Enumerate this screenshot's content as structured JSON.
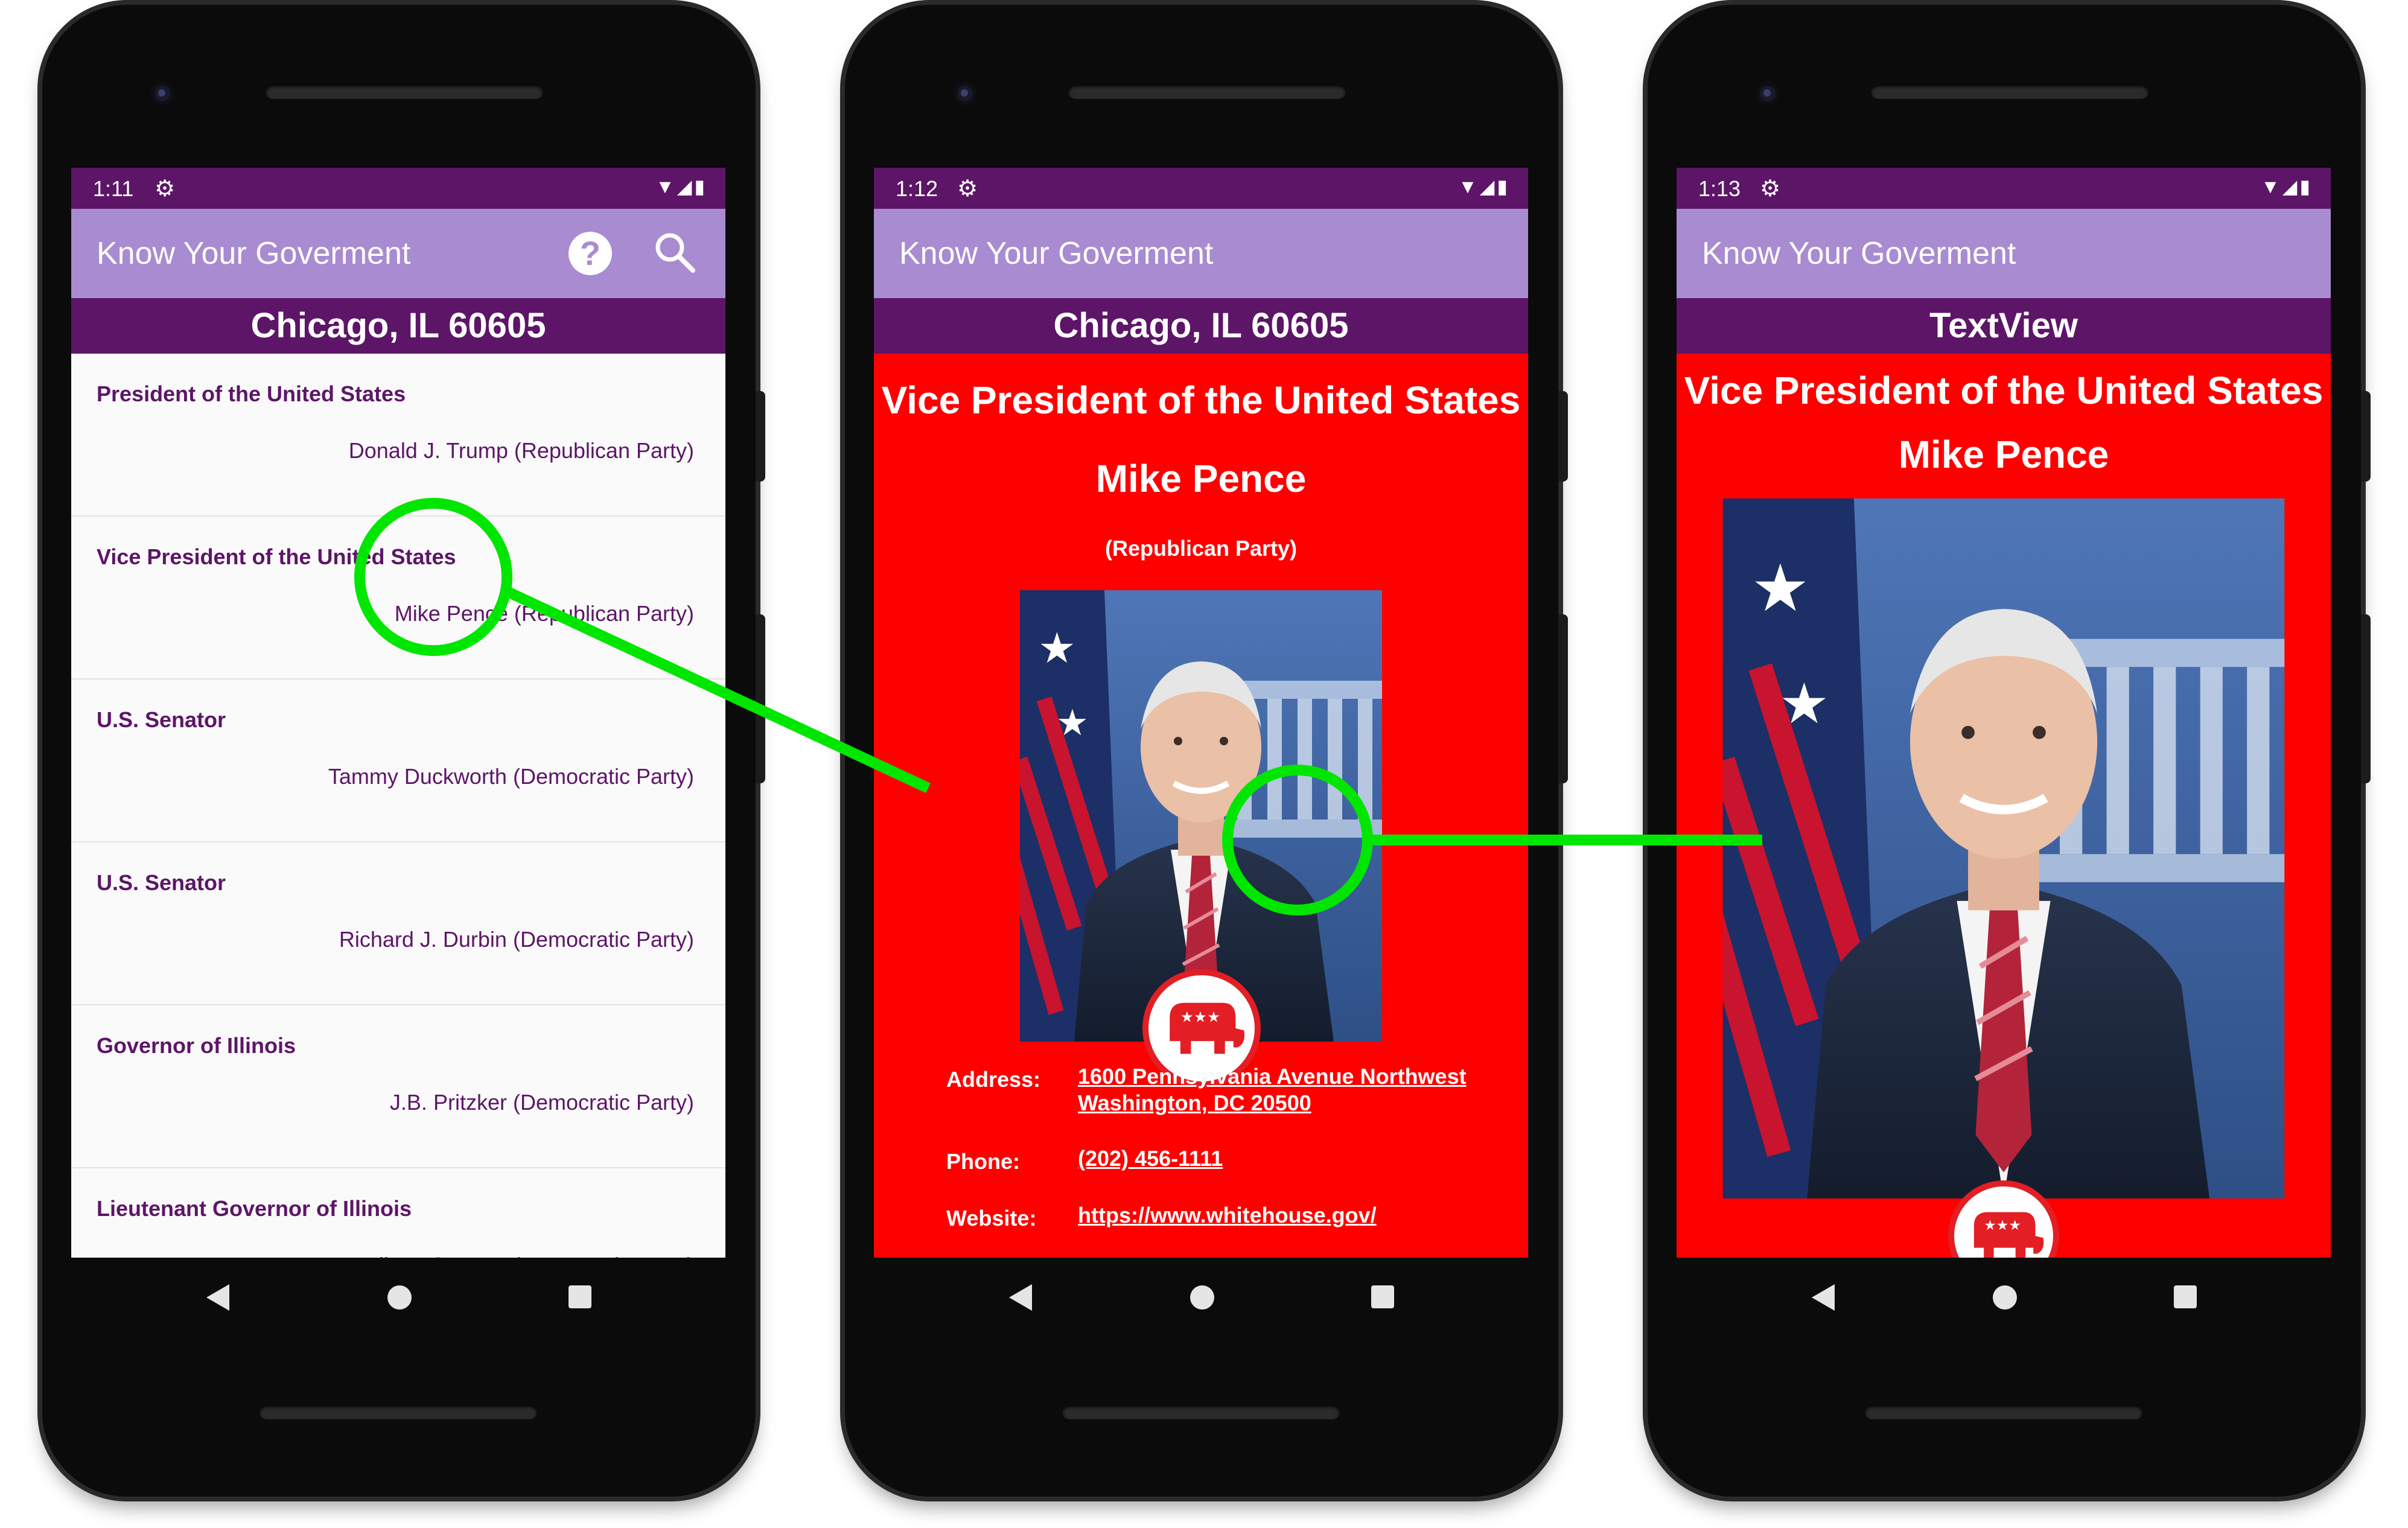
{
  "colors": {
    "status_bar": "#5d1568",
    "app_bar": "#a98bd1",
    "location_bar": "#5d1568",
    "list_text": "#5d1568",
    "detail_background": "#ff0000",
    "annotation": "#00e600"
  },
  "phone1": {
    "status": {
      "time": "1:11"
    },
    "app_title": "Know Your Goverment",
    "location": "Chicago, IL 60605",
    "officials": [
      {
        "office": "President of the United States",
        "official": "Donald J. Trump (Republican Party)"
      },
      {
        "office": "Vice President of the United States",
        "official": "Mike Pence (Republican Party)"
      },
      {
        "office": "U.S. Senator",
        "official": "Tammy Duckworth (Democratic Party)"
      },
      {
        "office": "U.S. Senator",
        "official": "Richard J. Durbin (Democratic Party)"
      },
      {
        "office": "Governor of Illinois",
        "official": "J.B. Pritzker (Democratic Party)"
      },
      {
        "office": "Lieutenant Governor of Illinois",
        "official": "Juliana Stratton (Democratic Party)"
      }
    ],
    "icons": [
      "gear-icon",
      "wifi-icon",
      "signal-icon",
      "battery-icon",
      "help-icon",
      "search-icon"
    ]
  },
  "phone2": {
    "status": {
      "time": "1:12"
    },
    "app_title": "Know Your Goverment",
    "location": "Chicago, IL 60605",
    "office": "Vice President of the United States",
    "name": "Mike Pence",
    "party": "(Republican Party)",
    "address_label": "Address:",
    "address_line1": "1600 Pennsylvania Avenue Northwest",
    "address_line2": "Washington, DC 20500",
    "phone_label": "Phone:",
    "phone_value": "(202) 456-1111",
    "website_label": "Website:",
    "website_value": "https://www.whitehouse.gov/"
  },
  "phone3": {
    "status": {
      "time": "1:13"
    },
    "app_title": "Know Your Goverment",
    "location": "TextView",
    "office": "Vice President of the United States",
    "name": "Mike Pence"
  }
}
